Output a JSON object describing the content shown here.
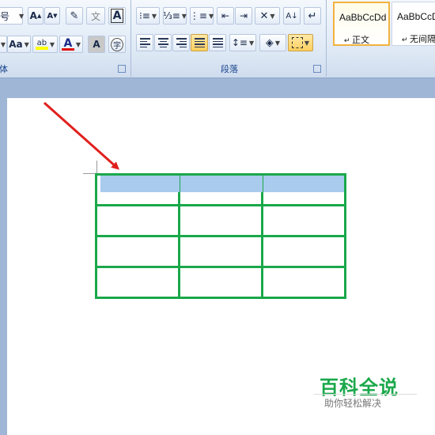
{
  "ribbon": {
    "font_group": {
      "label": "体",
      "size_fragment": "号",
      "grow_font": "A",
      "shrink_font": "A",
      "phonetic": "文",
      "char_border": "A",
      "change_case": "Aa",
      "highlight": "ab",
      "font_color": "A",
      "char_shading": "A",
      "enclose": "字"
    },
    "paragraph_group": {
      "label": "段落"
    },
    "styles_group": {
      "tiles": [
        {
          "sample": "AaBbCcDd",
          "name": "正文"
        },
        {
          "sample": "AaBbCcDd",
          "name": "无间隔"
        }
      ]
    }
  },
  "document": {
    "table": {
      "rows": 4,
      "cols": 3,
      "border_color": "#1aa84a",
      "selection_color": "#a9cbed"
    }
  },
  "watermark": {
    "title": "百科全说",
    "subtitle": "助你轻松解决"
  },
  "colors": {
    "ribbon_bg": "#dde8f5",
    "workspace_bg": "#9fb6d6",
    "arrow": "#e0201c",
    "highlight_btn": "#ffcf5d"
  }
}
